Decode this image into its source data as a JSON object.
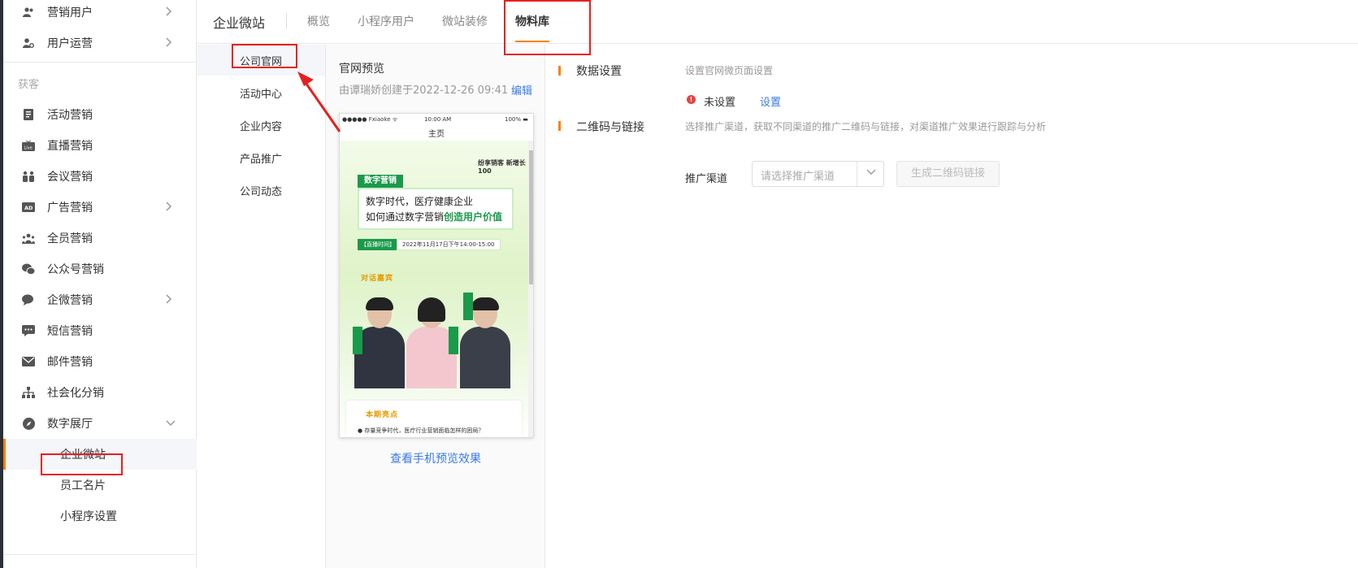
{
  "sidebar": {
    "items_top": [
      {
        "label": "营销用户",
        "icon": "users-icon",
        "chevron": true
      },
      {
        "label": "用户运营",
        "icon": "user-gear-icon",
        "chevron": true
      }
    ],
    "group_label": "获客",
    "items": [
      {
        "label": "活动营销",
        "icon": "document-icon",
        "chevron": false
      },
      {
        "label": "直播营销",
        "icon": "live-tv-icon",
        "chevron": false
      },
      {
        "label": "会议营销",
        "icon": "meeting-icon",
        "chevron": false
      },
      {
        "label": "广告营销",
        "icon": "ad-icon",
        "chevron": true
      },
      {
        "label": "全员营销",
        "icon": "team-icon",
        "chevron": false
      },
      {
        "label": "公众号营销",
        "icon": "wechat-icon",
        "chevron": false
      },
      {
        "label": "企微营销",
        "icon": "chat-icon",
        "chevron": true
      },
      {
        "label": "短信营销",
        "icon": "sms-icon",
        "chevron": false
      },
      {
        "label": "邮件营销",
        "icon": "mail-icon",
        "chevron": false
      },
      {
        "label": "社会化分销",
        "icon": "org-tree-icon",
        "chevron": false
      },
      {
        "label": "数字展厅",
        "icon": "compass-icon",
        "chevron": true
      }
    ],
    "sub_items": [
      {
        "label": "企业微站",
        "active": true
      },
      {
        "label": "员工名片",
        "active": false
      },
      {
        "label": "小程序设置",
        "active": false
      }
    ]
  },
  "topnav": {
    "title": "企业微站",
    "tabs": [
      "概览",
      "小程序用户",
      "微站装修",
      "物料库"
    ],
    "active_tab": "物料库"
  },
  "submenu": {
    "items": [
      "公司官网",
      "活动中心",
      "企业内容",
      "产品推广",
      "公司动态"
    ],
    "active": "公司官网"
  },
  "preview": {
    "title": "官网预览",
    "meta": "由谭瑞娇创建于2022-12-26 09:41",
    "edit_label": "编辑",
    "phone": {
      "carrier": "●●●●● Fxiaoke ᯤ",
      "time": "10:00 AM",
      "battery": "100% ▬",
      "page_title": "主页",
      "brand": "纷享销客 新增长100",
      "badge": "数字营销",
      "headline_line1": "数字时代，医疗健康企业",
      "headline_line2_prefix": "如何通过数字营销",
      "headline_line2_highlight": "创造用户价值",
      "time_badge": "【直播时间】",
      "time_text": "2022年11月17日下午14:00-15:00",
      "guests_title": "对话嘉宾",
      "highlights_title": "本期亮点",
      "highlights_item": "存量竞争时代，医疗行业营销面临怎样的困局？"
    },
    "phone_preview_link": "查看手机预览效果"
  },
  "settings": {
    "data_section": {
      "title": "数据设置",
      "desc": "设置官网微页面设置",
      "status": "未设置",
      "set_label": "设置"
    },
    "qr_section": {
      "title": "二维码与链接",
      "desc": "选择推广渠道，获取不同渠道的推广二维码与链接，对渠道推广效果进行跟踪与分析",
      "channel_label": "推广渠道",
      "channel_placeholder": "请选择推广渠道",
      "generate_label": "生成二维码链接"
    }
  },
  "colors": {
    "accent": "#ff8000",
    "link": "#3a7be8",
    "highlight_box": "#e81e1e",
    "brand_green": "#1a9a4b"
  }
}
